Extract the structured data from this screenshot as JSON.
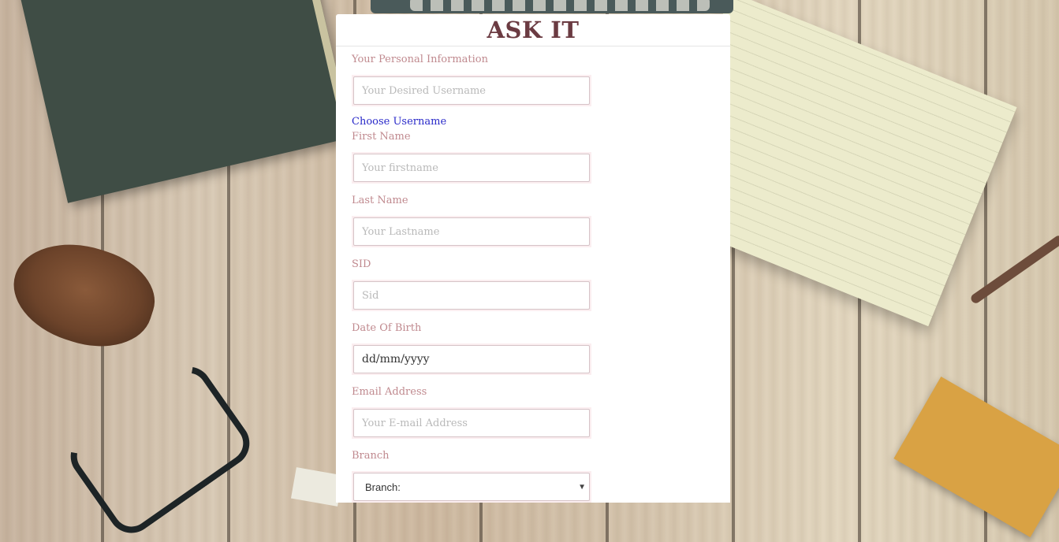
{
  "app": {
    "title": "ASK IT"
  },
  "form": {
    "section_label": "Your Personal Information",
    "username": {
      "placeholder": "Your Desired Username",
      "value": ""
    },
    "choose_username_link": "Choose Username",
    "first_name": {
      "label": "First Name",
      "placeholder": "Your firstname",
      "value": ""
    },
    "last_name": {
      "label": "Last Name",
      "placeholder": "Your Lastname",
      "value": ""
    },
    "sid": {
      "label": "SID",
      "placeholder": "Sid",
      "value": ""
    },
    "dob": {
      "label": "Date Of Birth",
      "display": "dd/mm/yyyy"
    },
    "email": {
      "label": "Email Address",
      "placeholder": "Your E-mail Address",
      "value": ""
    },
    "branch": {
      "label": "Branch",
      "selected": "Branch:",
      "icon": "chevron-down-icon"
    }
  },
  "colors": {
    "title": "#6b3b42",
    "label": "#c08a8f",
    "link": "#2929c9",
    "panel_bg": "#ffffff",
    "field_border": "#d6c3c7"
  }
}
